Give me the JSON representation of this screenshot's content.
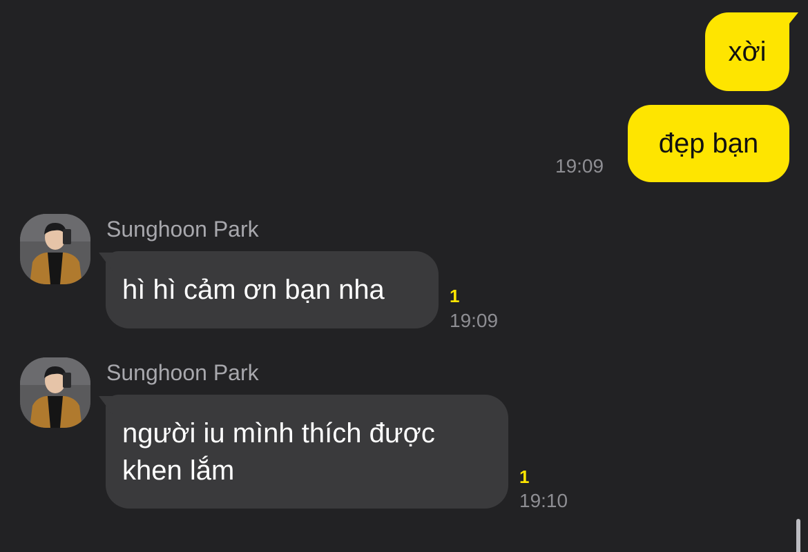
{
  "colors": {
    "background": "#222224",
    "outgoing_bubble": "#FEE500",
    "incoming_bubble": "#3A3A3C",
    "timestamp": "#8E8E93",
    "unread_indicator": "#FEE500"
  },
  "outgoing": [
    {
      "text": "xời"
    },
    {
      "text": "đẹp bạn",
      "time": "19:09"
    }
  ],
  "incoming": [
    {
      "avatar_icon": "profile-photo-avatar",
      "sender": "Sunghoon Park",
      "text": "hì hì cảm ơn bạn nha",
      "unread": "1",
      "time": "19:09"
    },
    {
      "avatar_icon": "profile-photo-avatar",
      "sender": "Sunghoon Park",
      "text_lines": [
        "người iu mình thích được",
        "khen lắm"
      ],
      "unread": "1",
      "time": "19:10"
    }
  ]
}
